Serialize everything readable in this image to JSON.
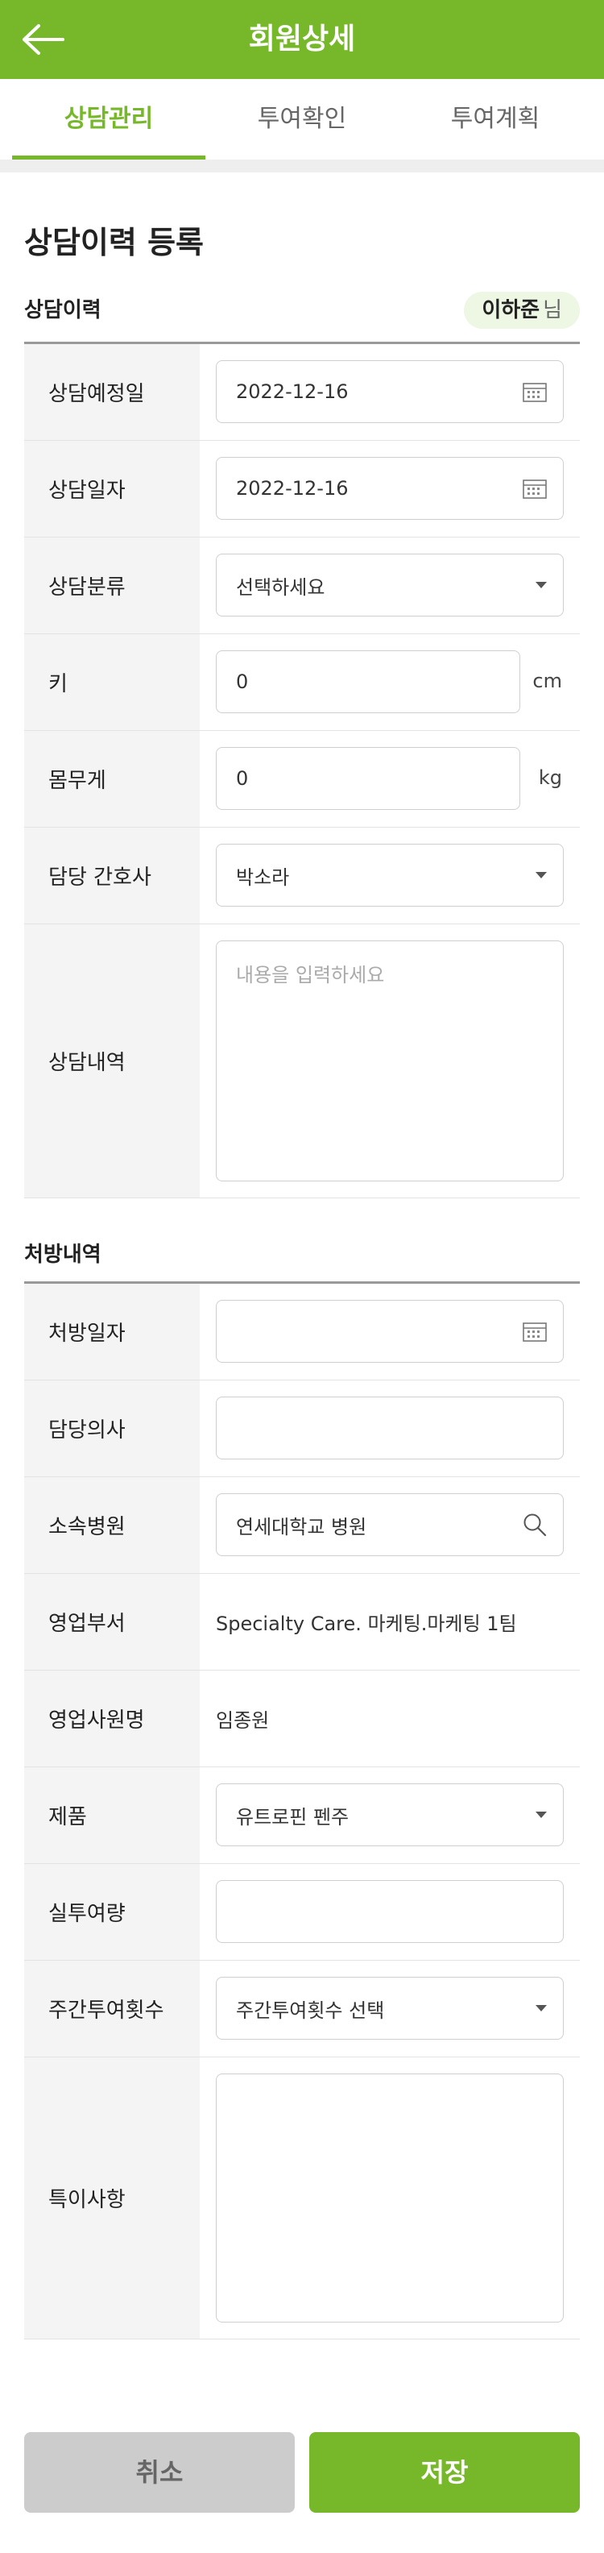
{
  "header": {
    "title": "회원상세",
    "back_icon": "arrow-left-icon"
  },
  "tabs": [
    {
      "label": "상담관리",
      "active": true
    },
    {
      "label": "투여확인",
      "active": false
    },
    {
      "label": "투여계획",
      "active": false
    }
  ],
  "page_title": "상담이력 등록",
  "consult_section": {
    "heading": "상담이력",
    "member_name": "이하준",
    "member_suffix": "님",
    "rows": {
      "planned_date": {
        "label": "상담예정일",
        "value": "2022-12-16"
      },
      "consult_date": {
        "label": "상담일자",
        "value": "2022-12-16"
      },
      "category": {
        "label": "상담분류",
        "value": "선택하세요"
      },
      "height": {
        "label": "키",
        "value": "0",
        "unit": "cm"
      },
      "weight": {
        "label": "몸무게",
        "value": "0",
        "unit": "kg"
      },
      "nurse": {
        "label": "담당 간호사",
        "value": "박소라"
      },
      "content": {
        "label": "상담내역",
        "placeholder": "내용을 입력하세요"
      }
    }
  },
  "prescription_section": {
    "heading": "처방내역",
    "rows": {
      "rx_date": {
        "label": "처방일자",
        "value": ""
      },
      "doctor": {
        "label": "담당의사",
        "value": ""
      },
      "hospital": {
        "label": "소속병원",
        "value": "연세대학교 병원"
      },
      "sales_dept": {
        "label": "영업부서",
        "value": "Specialty Care. 마케팅.마케팅 1팀"
      },
      "sales_rep": {
        "label": "영업사원명",
        "value": "임종원"
      },
      "product": {
        "label": "제품",
        "value": "유트로핀 펜주"
      },
      "actual_dose": {
        "label": "실투여량",
        "value": ""
      },
      "weekly_count": {
        "label": "주간투여횟수",
        "value": "주간투여횟수 선택"
      },
      "notes": {
        "label": "특이사항",
        "value": ""
      }
    }
  },
  "buttons": {
    "cancel": "취소",
    "save": "저장"
  },
  "colors": {
    "brand": "#76b82a",
    "label_bg": "#f4f4f4",
    "badge_bg": "#eef6e4"
  }
}
